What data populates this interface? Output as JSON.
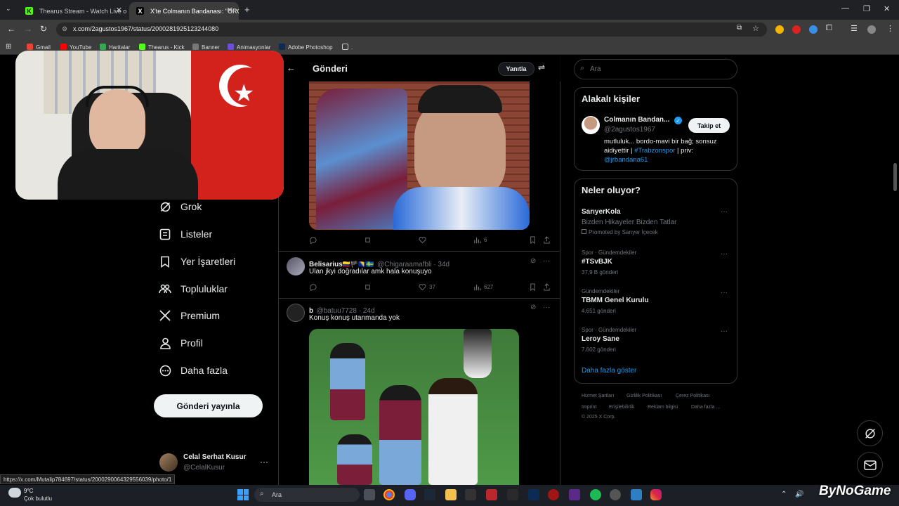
{
  "browser": {
    "tabs": [
      {
        "title": "Thearus Stream - Watch Live o",
        "favicon": "kick-icon",
        "color": "#53fc18"
      },
      {
        "title": "X'te Colmanın Bandanası: \"ORO",
        "favicon": "x-icon",
        "color": "#ffffff"
      }
    ],
    "url": "x.com/2agustos1967/status/2000281925123244080",
    "bookmarks": [
      "Gmail",
      "YouTube",
      "Haritalar",
      "Thearus - Kick",
      "Banner",
      "Animasyonlar",
      "Adobe Photoshop",
      "."
    ],
    "status_url": "https://x.com/Mutalip784697/status/2000290064329556039/photo/1"
  },
  "nav": {
    "items": [
      {
        "label": "Grok",
        "icon": "grok-icon"
      },
      {
        "label": "Listeler",
        "icon": "list-icon"
      },
      {
        "label": "Yer İşaretleri",
        "icon": "bookmark-icon"
      },
      {
        "label": "Topluluklar",
        "icon": "communities-icon"
      },
      {
        "label": "Premium",
        "icon": "x-logo-icon"
      },
      {
        "label": "Profil",
        "icon": "person-icon"
      },
      {
        "label": "Daha fazla",
        "icon": "more-circle-icon"
      }
    ],
    "post_button": "Gönderi yayınla",
    "profile": {
      "name": "Celal Serhat Kusur",
      "handle": "@CelalKusur"
    }
  },
  "header": {
    "title": "Gönderi",
    "reply_label": "Yanıtla"
  },
  "posts": [
    {
      "stats": {
        "replies": "",
        "reposts": "",
        "likes": "",
        "views": "6"
      }
    },
    {
      "name": "Belisarius",
      "flags": "🇨🇴🏴🇧🇦🇸🇪",
      "handle": "@Chigaraamafbli",
      "time": "34d",
      "text": "Ulan jkyi doğradılar amk hala konuşuyo",
      "stats": {
        "replies": "",
        "reposts": "",
        "likes": "37",
        "views": "627"
      }
    },
    {
      "name": "b",
      "handle": "@batuu7728",
      "time": "24d",
      "text": "Konuş konuş utanmanda yok"
    }
  ],
  "right": {
    "search_placeholder": "Ara",
    "related_title": "Alakalı kişiler",
    "related_person": {
      "name": "Colmanın Bandan...",
      "handle": "@2agustos1967",
      "follow_label": "Takip et",
      "bio_1": "mutluluk... bordo-mavi bir bağ; sonsuz",
      "bio_2": "aidiyettir |",
      "bio_tag": "#Trabzonspor",
      "bio_3": "| priv:",
      "bio_mention": "@jrbandana61"
    },
    "trends_title": "Neler oluyor?",
    "promo": {
      "name": "SarıyerKola",
      "sub": "Bizden Hikayeler Bizden Tatlar",
      "promoted": "Promoted by Sarıyer İçecek"
    },
    "trends": [
      {
        "category": "Spor · Gündemdekiler",
        "name": "#TSvBJK",
        "count": "37,9 B gönderi"
      },
      {
        "category": "Gündemdekiler",
        "name": "TBMM Genel Kurulu",
        "count": "4.651 gönderi"
      },
      {
        "category": "Spor · Gündemdekiler",
        "name": "Leroy Sane",
        "count": "7.602 gönderi"
      }
    ],
    "show_more": "Daha fazla göster",
    "footer": [
      "Hizmet Şartları",
      "Gizlilik Politikası",
      "Çerez Politikası",
      "Imprint",
      "Erişilebilirlik",
      "Reklam bilgisi",
      "Daha fazla ...",
      "© 2025 X Corp."
    ]
  },
  "taskbar": {
    "weather_temp": "9°C",
    "weather_desc": "Çok bulutlu",
    "search_label": "Ara",
    "watermark": "ByNoGame"
  }
}
